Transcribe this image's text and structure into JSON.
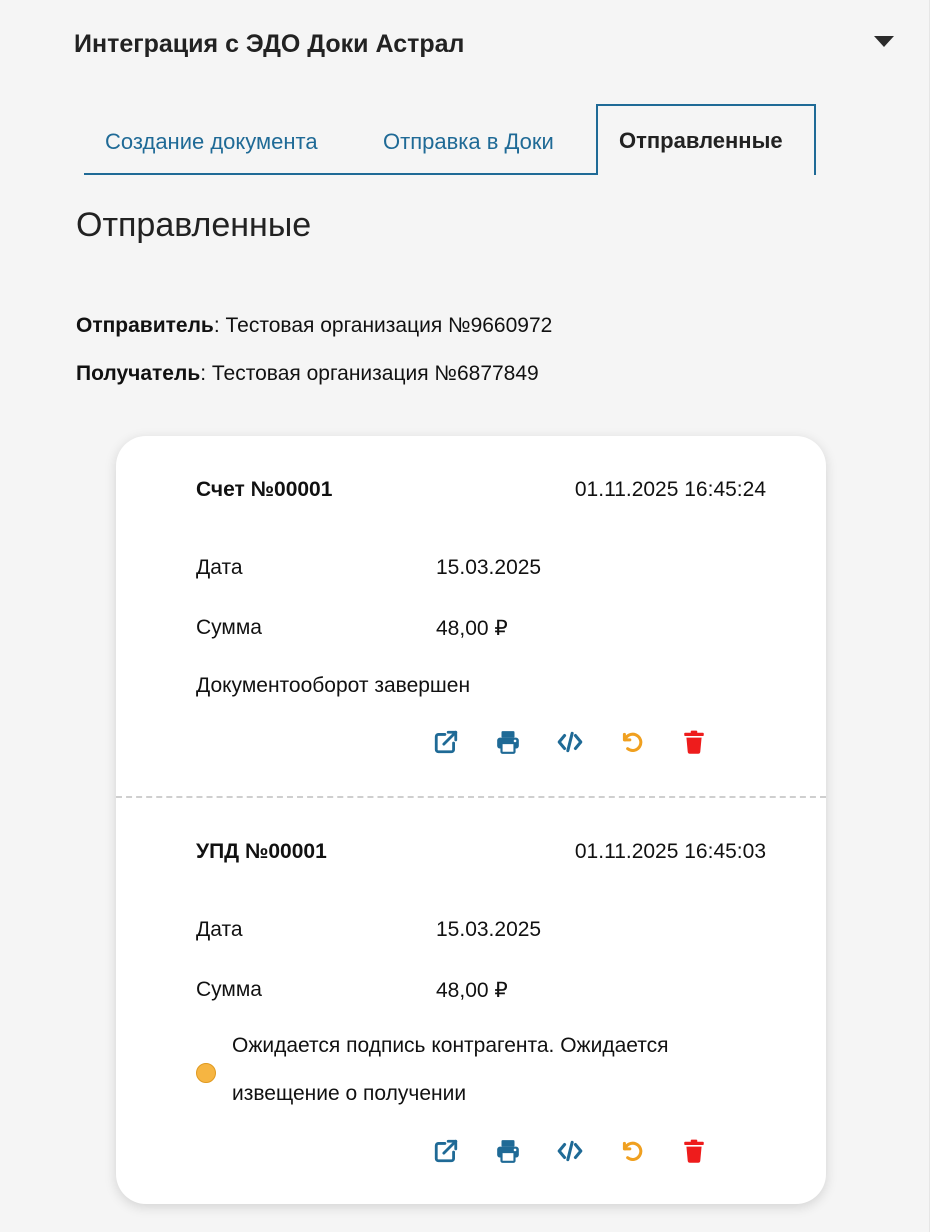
{
  "header": {
    "title": "Интеграция с ЭДО Доки Астрал",
    "toggle_icon": "caret-down-icon"
  },
  "tabs": [
    {
      "label": "Создание документа",
      "active": false
    },
    {
      "label": "Отправка в Доки",
      "active": false
    },
    {
      "label": "Отправленные",
      "active": true
    }
  ],
  "section": {
    "title": "Отправленные",
    "sender_label": "Отправитель",
    "sender_value": ": Тестовая организация №9660972",
    "recipient_label": "Получатель",
    "recipient_value": ": Тестовая организация №6877849"
  },
  "documents": [
    {
      "title": "Счет №00001",
      "timestamp": "01.11.2025 16:45:24",
      "date_label": "Дата",
      "date_value": "15.03.2025",
      "sum_label": "Сумма",
      "sum_value": "48,00 ₽",
      "status": "Документооборот завершен"
    },
    {
      "title": "УПД №00001",
      "timestamp": "01.11.2025 16:45:03",
      "date_label": "Дата",
      "date_value": "15.03.2025",
      "sum_label": "Сумма",
      "sum_value": "48,00 ₽",
      "status": "Ожидается подпись контрагента. Ожидается извещение о получении",
      "status_dot_color": "#f6b542"
    }
  ],
  "actions": [
    {
      "icon": "external-link-icon",
      "color": "#1f6a96"
    },
    {
      "icon": "print-icon",
      "color": "#1f6a96"
    },
    {
      "icon": "code-icon",
      "color": "#1f6a96"
    },
    {
      "icon": "undo-icon",
      "color": "#f0a020"
    },
    {
      "icon": "trash-icon",
      "color": "#ee1c1c"
    }
  ],
  "colors": {
    "accent": "#1f6a96",
    "panel_bg": "#f5f5f5",
    "card_bg": "#ffffff"
  }
}
